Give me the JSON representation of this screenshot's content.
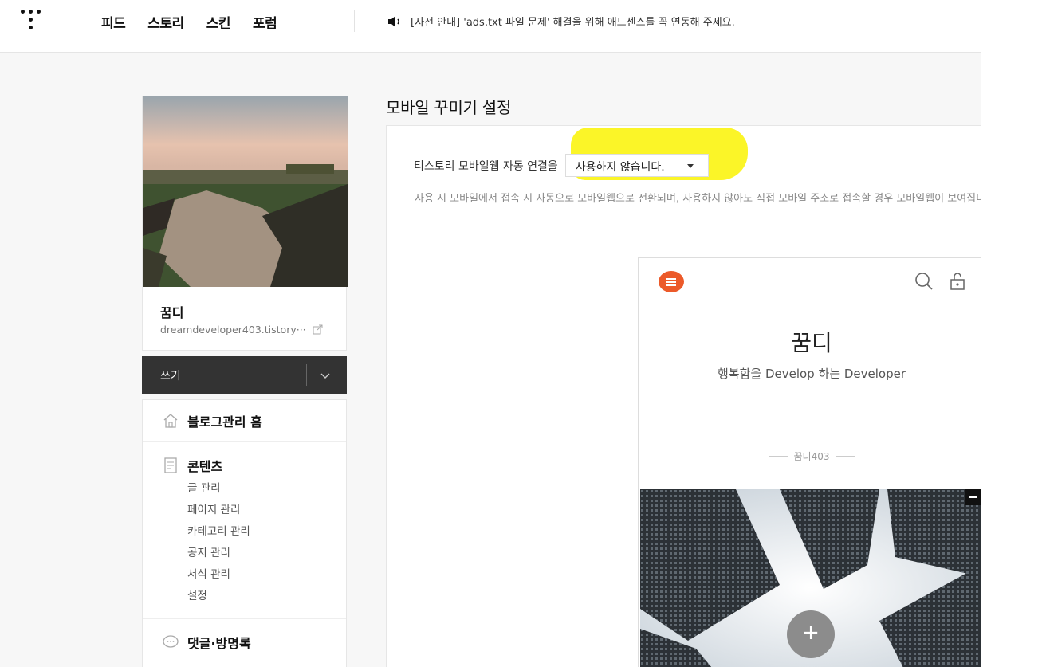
{
  "topbar": {
    "nav": [
      "피드",
      "스토리",
      "스킨",
      "포럼"
    ],
    "notice": "[사전 안내] 'ads.txt 파일 문제' 해결을 위해 애드센스를 꼭 연동해 주세요."
  },
  "sidebar": {
    "blog_name": "꿈디",
    "blog_url": "dreamdeveloper403.tistory···",
    "write_label": "쓰기",
    "menu": {
      "home_label": "블로그관리 홈",
      "content_label": "콘텐츠",
      "content_items": [
        "글 관리",
        "페이지 관리",
        "카테고리 관리",
        "공지 관리",
        "서식 관리",
        "설정"
      ],
      "comments_label": "댓글·방명록"
    }
  },
  "main": {
    "title": "모바일 꾸미기 설정",
    "setting_label": "티스토리 모바일웹 자동 연결을",
    "select_value": "사용하지 않습니다.",
    "help_text": "사용 시 모바일에서 접속 시 자동으로 모바일웹으로 전환되며, 사용하지 않아도 직접 모바일 주소로 접속할 경우 모바일웹이 보여집니다."
  },
  "preview": {
    "title": "꿈디",
    "description": "행복함을 Develop 하는 Developer",
    "author": "꿈디403",
    "plus": "+"
  },
  "colors": {
    "highlight": "#fbf528",
    "menu_button": "#ec5a2a",
    "write_bar": "#333333"
  }
}
